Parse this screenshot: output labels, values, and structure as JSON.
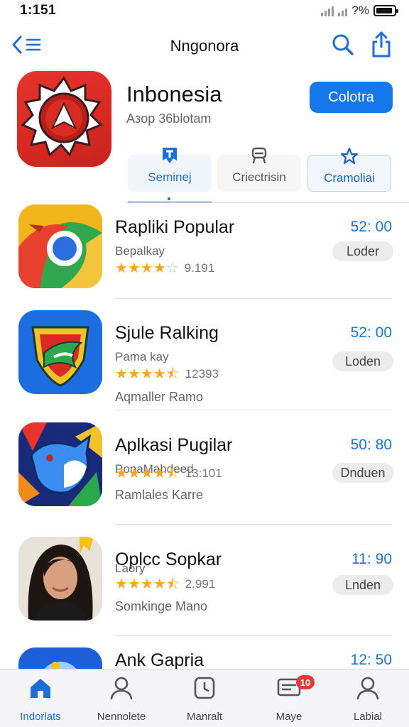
{
  "status_bar": {
    "time": "1:151",
    "battery": "?%"
  },
  "nav": {
    "title": "Nngonora"
  },
  "header": {
    "title": "Inbonesia",
    "subtitle": "Aзop 36blotam",
    "action_label": "Colotra"
  },
  "tabs": [
    {
      "label": "Seminej"
    },
    {
      "label": "Criectrisin"
    },
    {
      "label": "Cramoliai"
    }
  ],
  "apps": [
    {
      "name": "Rapliki Popular",
      "sub": "Bepalkay",
      "rating": 4,
      "rating_count": "9.191",
      "extra": "",
      "price": "52: 00",
      "button": "Loder"
    },
    {
      "name": "Sjule Ralking",
      "sub": "Pama kay",
      "rating": 4.5,
      "rating_count": "12393",
      "extra": "Aqmaller Ramo",
      "price": "52: 00",
      "button": "Loden"
    },
    {
      "name": "Aplkasi Pugilar",
      "sub": "PonaMahdeed",
      "rating": 4.5,
      "rating_count": "13:101",
      "extra": "Ramlales Karre",
      "price": "50: 80",
      "button": "Dnduen"
    },
    {
      "name": "Oplcc Sopkar",
      "sub": "Laory",
      "rating": 4.5,
      "rating_count": "2.991",
      "extra": "Somkinge Mano",
      "price": "11: 90",
      "button": "Lnden"
    },
    {
      "name": "Ank Gapria",
      "sub": "",
      "rating": 0,
      "rating_count": "",
      "extra": "",
      "price": "12: 50",
      "button": ""
    }
  ],
  "tab_bar": [
    {
      "label": "Indorlats",
      "icon": "home-icon",
      "active": true
    },
    {
      "label": "Nennolete",
      "icon": "person-icon"
    },
    {
      "label": "Manralt",
      "icon": "clock-icon"
    },
    {
      "label": "Maye",
      "icon": "message-icon",
      "badge": "10"
    },
    {
      "label": "Labial",
      "icon": "profile-icon"
    }
  ],
  "colors": {
    "accent": "#1677e8",
    "star": "#f5a623",
    "badge": "#e53935"
  }
}
